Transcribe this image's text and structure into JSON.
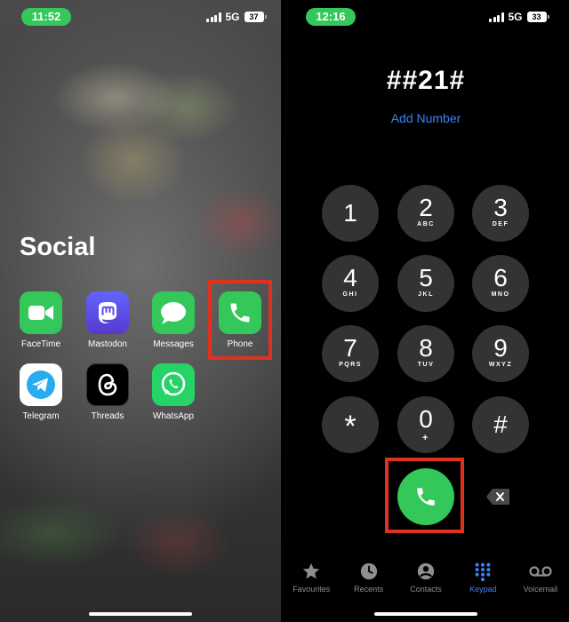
{
  "left_screen": {
    "status": {
      "time": "11:52",
      "network": "5G",
      "battery": "37"
    },
    "folder_title": "Social",
    "apps": [
      {
        "label": "FaceTime",
        "icon": "facetime-icon",
        "color": "#34c759"
      },
      {
        "label": "Mastodon",
        "icon": "mastodon-icon",
        "color": "#6364ff"
      },
      {
        "label": "Messages",
        "icon": "messages-icon",
        "color": "#34c759"
      },
      {
        "label": "Phone",
        "icon": "phone-icon",
        "color": "#34c759",
        "highlighted": true
      },
      {
        "label": "Telegram",
        "icon": "telegram-icon",
        "color": "#2aabee"
      },
      {
        "label": "Threads",
        "icon": "threads-icon",
        "color": "#000000"
      },
      {
        "label": "WhatsApp",
        "icon": "whatsapp-icon",
        "color": "#25d366"
      }
    ]
  },
  "right_screen": {
    "status": {
      "time": "12:16",
      "network": "5G",
      "battery": "33"
    },
    "dialed_number": "##21#",
    "add_number_label": "Add Number",
    "keys": [
      {
        "digit": "1",
        "letters": ""
      },
      {
        "digit": "2",
        "letters": "ABC"
      },
      {
        "digit": "3",
        "letters": "DEF"
      },
      {
        "digit": "4",
        "letters": "GHI"
      },
      {
        "digit": "5",
        "letters": "JKL"
      },
      {
        "digit": "6",
        "letters": "MNO"
      },
      {
        "digit": "7",
        "letters": "PQRS"
      },
      {
        "digit": "8",
        "letters": "TUV"
      },
      {
        "digit": "9",
        "letters": "WXYZ"
      },
      {
        "digit": "*",
        "letters": ""
      },
      {
        "digit": "0",
        "letters": "+"
      },
      {
        "digit": "#",
        "letters": ""
      }
    ],
    "tabs": [
      {
        "label": "Favourites",
        "icon": "star-icon"
      },
      {
        "label": "Recents",
        "icon": "clock-icon"
      },
      {
        "label": "Contacts",
        "icon": "person-icon"
      },
      {
        "label": "Keypad",
        "icon": "keypad-icon",
        "active": true
      },
      {
        "label": "Voicemail",
        "icon": "voicemail-icon"
      }
    ]
  },
  "colors": {
    "green": "#34c759",
    "accent_blue": "#3b82f6",
    "highlight_red": "#e0301e",
    "key_gray": "#333335"
  }
}
